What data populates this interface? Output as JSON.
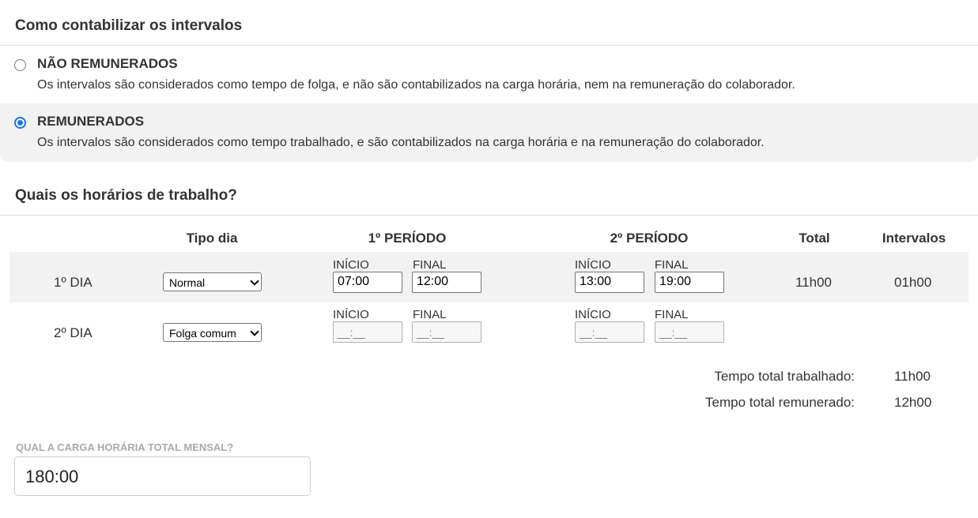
{
  "section1": {
    "title": "Como contabilizar os intervalos",
    "options": [
      {
        "title": "NÃO REMUNERADOS",
        "description": "Os intervalos são considerados como tempo de folga, e não são contabilizados na carga horária, nem na remuneração do colaborador.",
        "selected": false
      },
      {
        "title": "REMUNERADOS",
        "description": "Os intervalos são considerados como tempo trabalhado, e são contabilizados na carga horária e na remuneração do colaborador.",
        "selected": true
      }
    ]
  },
  "section2": {
    "title": "Quais os horários de trabalho?",
    "columns": {
      "tipo_dia": "Tipo dia",
      "periodo1": "1º PERÍODO",
      "periodo2": "2º PERÍODO",
      "total": "Total",
      "intervalos": "Intervalos"
    },
    "field_labels": {
      "inicio": "INÍCIO",
      "final": "FINAL"
    },
    "rows": [
      {
        "day": "1º DIA",
        "tipo": "Normal",
        "p1_inicio": "07:00",
        "p1_final": "12:00",
        "p2_inicio": "13:00",
        "p2_final": "19:00",
        "total": "11h00",
        "intervalos": "01h00"
      },
      {
        "day": "2º DIA",
        "tipo": "Folga comum",
        "p1_inicio": "__:__",
        "p1_final": "__:__",
        "p2_inicio": "__:__",
        "p2_final": "__:__",
        "total": "",
        "intervalos": ""
      }
    ],
    "summary": {
      "trabalhado_label": "Tempo total trabalhado:",
      "trabalhado_value": "11h00",
      "remunerado_label": "Tempo total remunerado:",
      "remunerado_value": "12h00"
    }
  },
  "carga": {
    "label": "QUAL A CARGA HORÁRIA TOTAL MENSAL?",
    "value": "180:00"
  },
  "colors": {
    "accent": "#1a73e8",
    "selected_bg": "#f2f2f2"
  }
}
